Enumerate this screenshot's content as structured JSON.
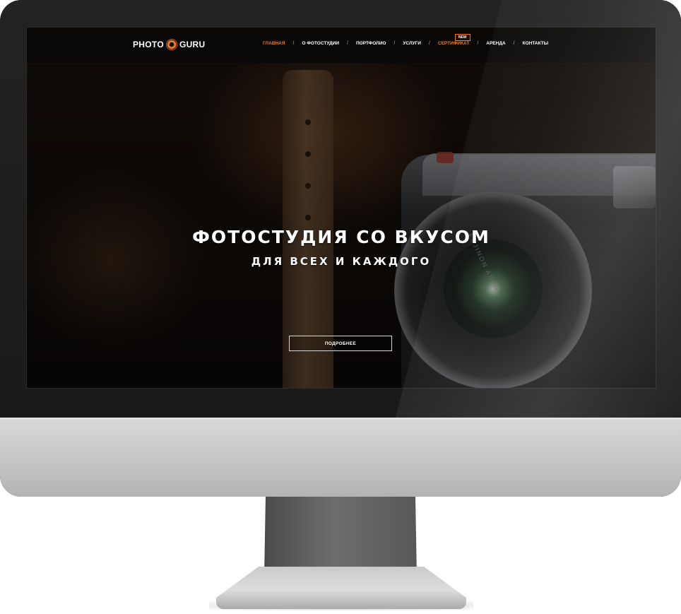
{
  "site": {
    "logo": {
      "left": "PHOTO",
      "right": "GURU"
    },
    "nav": {
      "items": [
        {
          "label": "ГЛАВНАЯ",
          "active": true
        },
        {
          "label": "О ФОТОСТУДИИ"
        },
        {
          "label": "ПОРТФОЛИО"
        },
        {
          "label": "УСЛУГИ"
        },
        {
          "label": "СЕРТИФИКАТ",
          "badge": "NEW"
        },
        {
          "label": "АРЕНДА"
        },
        {
          "label": "КОНТАКТЫ"
        }
      ],
      "separator": "/"
    },
    "hero": {
      "title": "ФОТОСТУДИЯ СО ВКУСОМ",
      "subtitle": "ДЛЯ ВСЕХ И КАЖДОГО",
      "button_label": "ПОДРОБНЕЕ",
      "lens_text": "FUJINON ASPH"
    }
  },
  "colors": {
    "accent": "#f07a1a",
    "nav_bg": "#080808",
    "bezel": "#1b1b1b",
    "chin": "#c9cacc"
  }
}
